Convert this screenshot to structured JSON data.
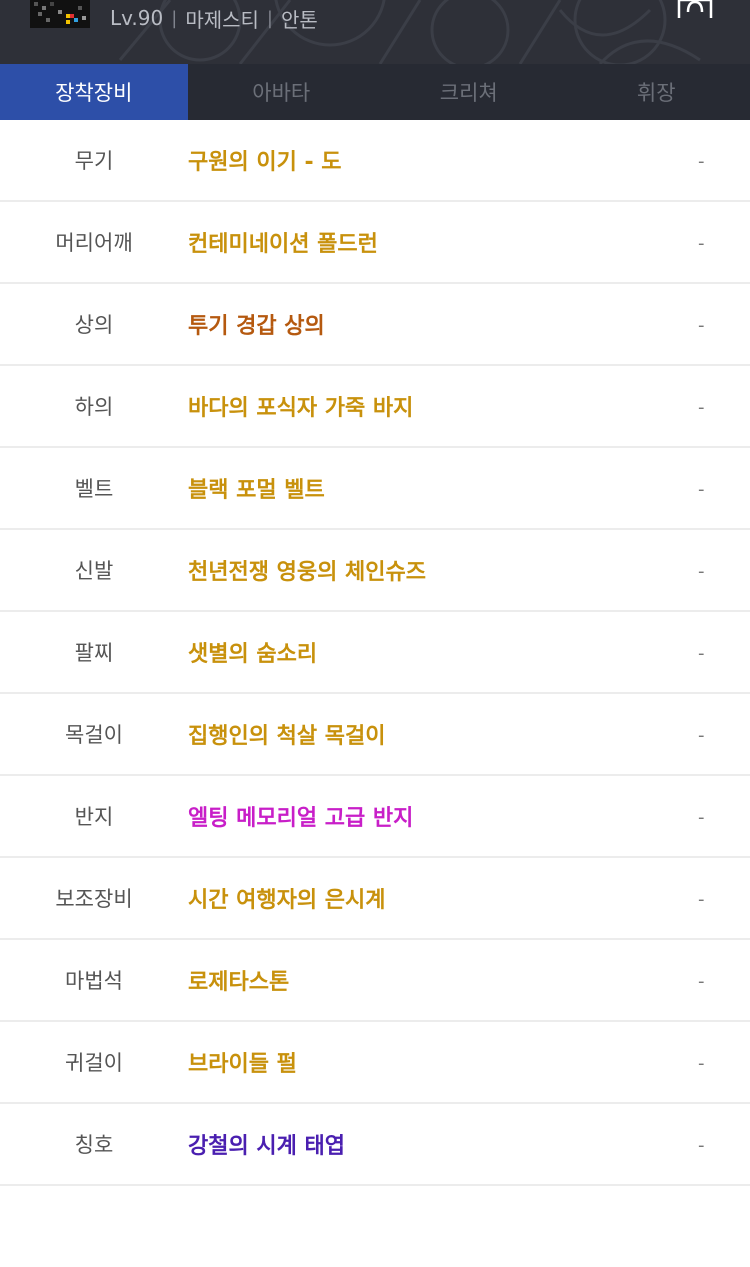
{
  "header": {
    "level": "Lv.90",
    "job": "마제스티",
    "server": "안톤",
    "separator": "|"
  },
  "icons": {
    "avatar": "character-avatar",
    "bag": "inventory-bag-icon"
  },
  "tabs": [
    {
      "label": "장착장비",
      "active": true
    },
    {
      "label": "아바타",
      "active": false
    },
    {
      "label": "크리쳐",
      "active": false
    },
    {
      "label": "휘장",
      "active": false
    }
  ],
  "equipment": [
    {
      "slot": "무기",
      "item": "구원의 이기 - 도",
      "color": "#c8910c",
      "value": "-"
    },
    {
      "slot": "머리어깨",
      "item": "컨테미네이션 폴드런",
      "color": "#c8910c",
      "value": "-"
    },
    {
      "slot": "상의",
      "item": "투기 경갑 상의",
      "color": "#b5590f",
      "value": "-"
    },
    {
      "slot": "하의",
      "item": "바다의 포식자 가죽 바지",
      "color": "#c8910c",
      "value": "-"
    },
    {
      "slot": "벨트",
      "item": "블랙 포멀 벨트",
      "color": "#c8910c",
      "value": "-"
    },
    {
      "slot": "신발",
      "item": "천년전쟁 영웅의 체인슈즈",
      "color": "#c8910c",
      "value": "-"
    },
    {
      "slot": "팔찌",
      "item": "샛별의 숨소리",
      "color": "#c8910c",
      "value": "-"
    },
    {
      "slot": "목걸이",
      "item": "집행인의 척살 목걸이",
      "color": "#c8910c",
      "value": "-"
    },
    {
      "slot": "반지",
      "item": "엘팅 메모리얼 고급 반지",
      "color": "#c81ec8",
      "value": "-"
    },
    {
      "slot": "보조장비",
      "item": "시간 여행자의 은시계",
      "color": "#c8910c",
      "value": "-"
    },
    {
      "slot": "마법석",
      "item": "로제타스톤",
      "color": "#c8910c",
      "value": "-"
    },
    {
      "slot": "귀걸이",
      "item": "브라이들 펄",
      "color": "#c8910c",
      "value": "-"
    },
    {
      "slot": "칭호",
      "item": "강철의 시계 태엽",
      "color": "#4a1fb0",
      "value": "-"
    }
  ]
}
